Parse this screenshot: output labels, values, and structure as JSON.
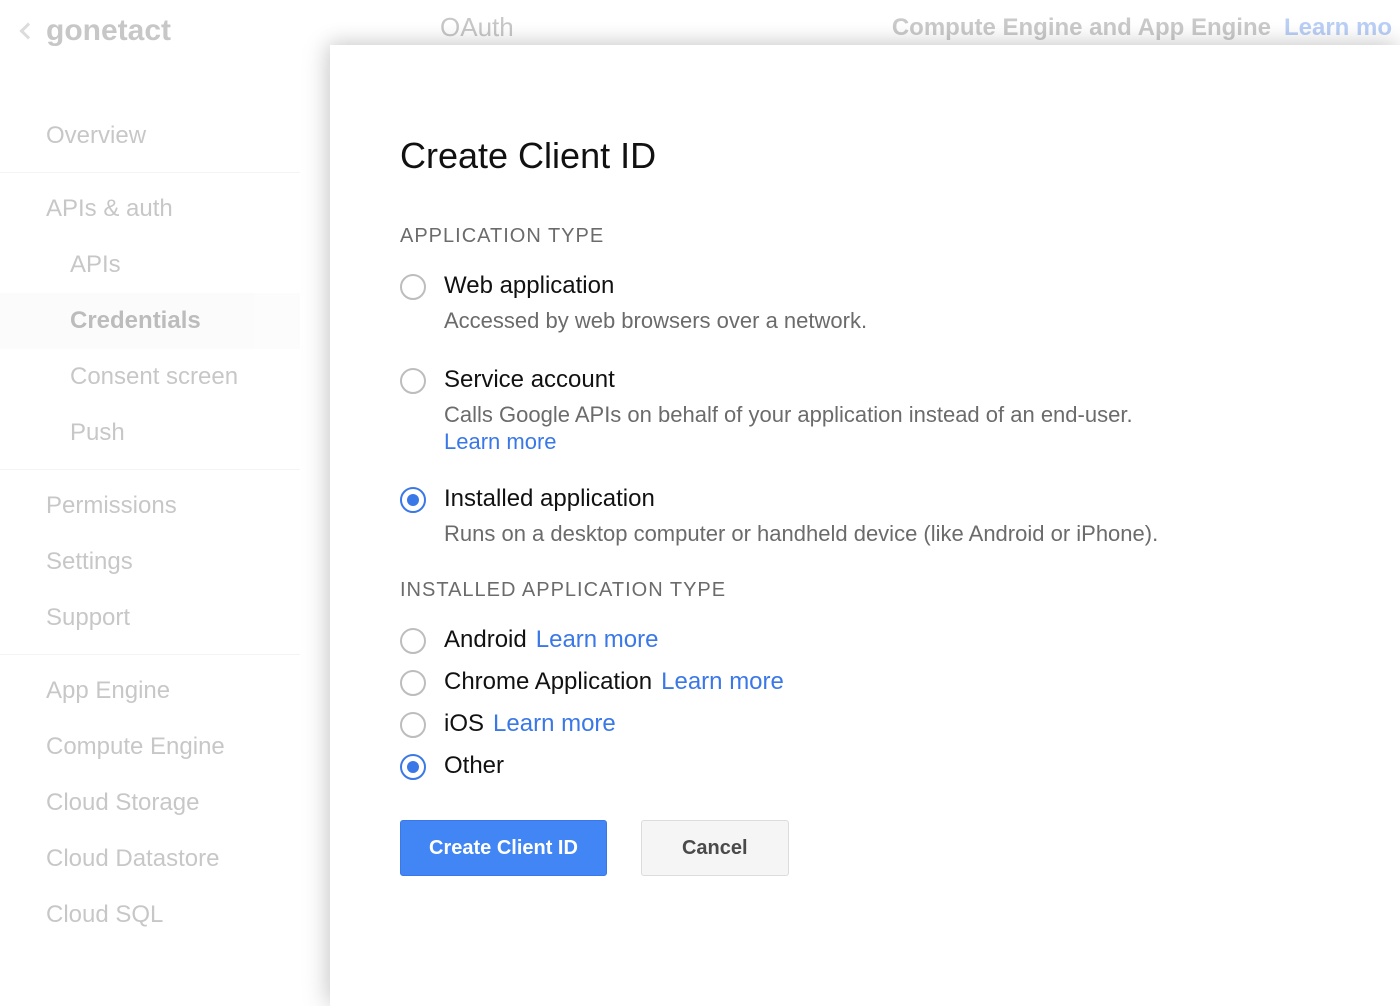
{
  "bg": {
    "project": "gonetact",
    "oauth": "OAuth",
    "compute_text": "Compute Engine and App Engine",
    "learn_more": "Learn mo",
    "sidebar": {
      "overview": "Overview",
      "apis_auth": "APIs & auth",
      "apis": "APIs",
      "credentials": "Credentials",
      "consent": "Consent screen",
      "push": "Push",
      "permissions": "Permissions",
      "settings": "Settings",
      "support": "Support",
      "app_engine": "App Engine",
      "compute_engine": "Compute Engine",
      "cloud_storage": "Cloud Storage",
      "cloud_datastore": "Cloud Datastore",
      "cloud_sql": "Cloud SQL"
    }
  },
  "modal": {
    "title": "Create Client ID",
    "app_type_label": "APPLICATION TYPE",
    "options": {
      "web": {
        "title": "Web application",
        "desc": "Accessed by web browsers over a network."
      },
      "service": {
        "title": "Service account",
        "desc": "Calls Google APIs on behalf of your application instead of an end-user.",
        "learn_more": "Learn more"
      },
      "installed": {
        "title": "Installed application",
        "desc": "Runs on a desktop computer or handheld device (like Android or iPhone)."
      }
    },
    "installed_label": "INSTALLED APPLICATION TYPE",
    "installed_types": {
      "android": "Android",
      "chrome": "Chrome Application",
      "ios": "iOS",
      "other": "Other",
      "learn_more": "Learn more"
    },
    "buttons": {
      "create": "Create Client ID",
      "cancel": "Cancel"
    }
  }
}
